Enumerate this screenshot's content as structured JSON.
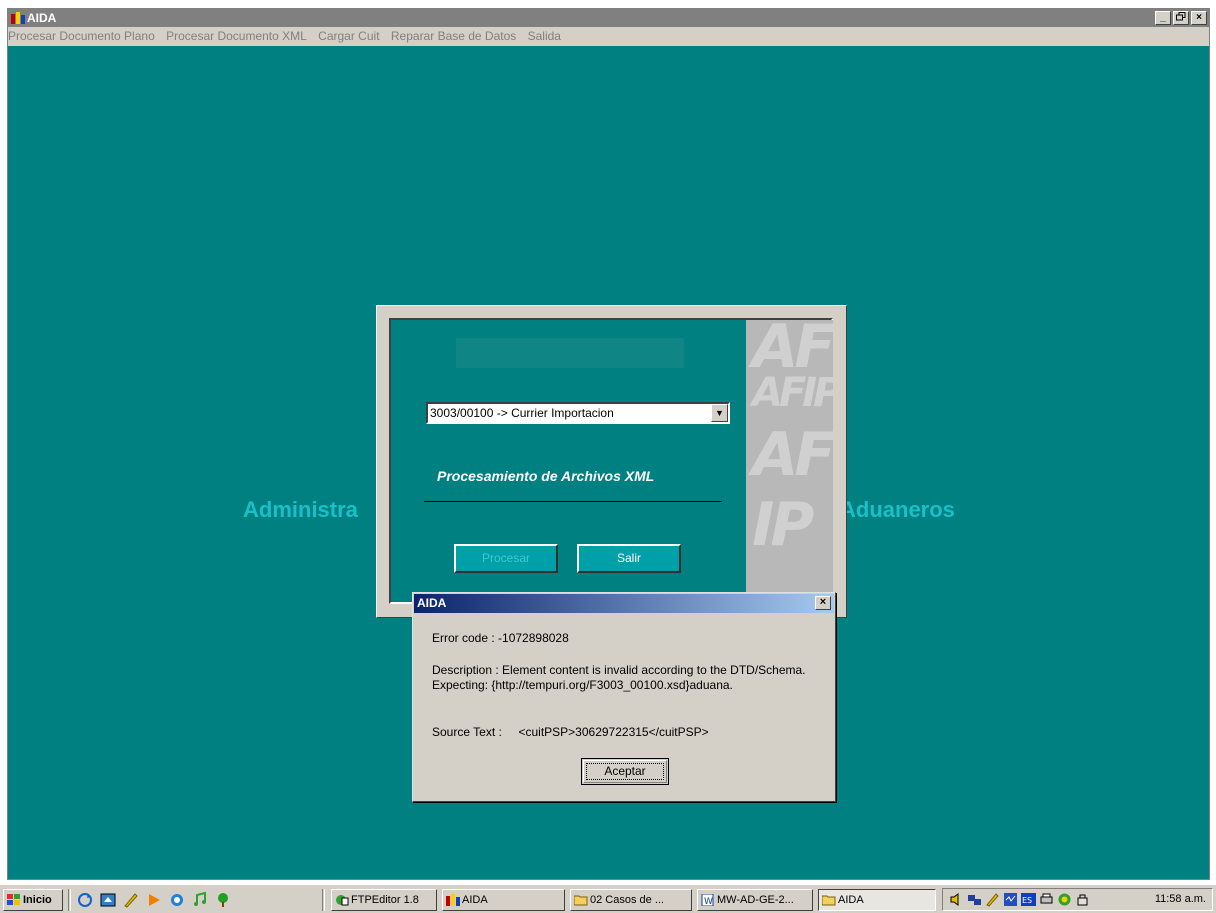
{
  "window": {
    "title": "AIDA",
    "minimize": "_",
    "maximize": "²",
    "close": "×"
  },
  "menu": [
    "Procesar Documento Plano",
    "Procesar Documento XML",
    "Cargar Cuit",
    "Reparar Base de Datos",
    "Salida"
  ],
  "background": {
    "heading_left": "Administra",
    "heading_right": "Aduaneros"
  },
  "proc_dialog": {
    "select_value": "3003/00100 -> Currier Importacion",
    "heading": "Procesamiento de Archivos XML",
    "btn_procesar": "Procesar",
    "btn_salir": "Salir",
    "logo_text": "AFIP"
  },
  "error_dialog": {
    "title": "AIDA",
    "error_code": "Error code : -1072898028",
    "description_line1": "Description : Element content is invalid according to the DTD/Schema.",
    "description_line2": "Expecting: {http://tempuri.org/F3003_00100.xsd}aduana.",
    "source_text": "Source Text :     <cuitPSP>30629722315</cuitPSP>",
    "ok_button": "Aceptar"
  },
  "taskbar": {
    "start": "Inicio",
    "tasks": [
      "FTPEditor 1.8",
      "AIDA",
      "02 Casos de ...",
      "MW-AD-GE-2...",
      "AIDA"
    ],
    "clock": "11:58 a.m."
  },
  "colors": {
    "desktop": "#008080",
    "title_active": "#0a246a",
    "title_inactive": "#808080",
    "face": "#d4d0c8"
  }
}
